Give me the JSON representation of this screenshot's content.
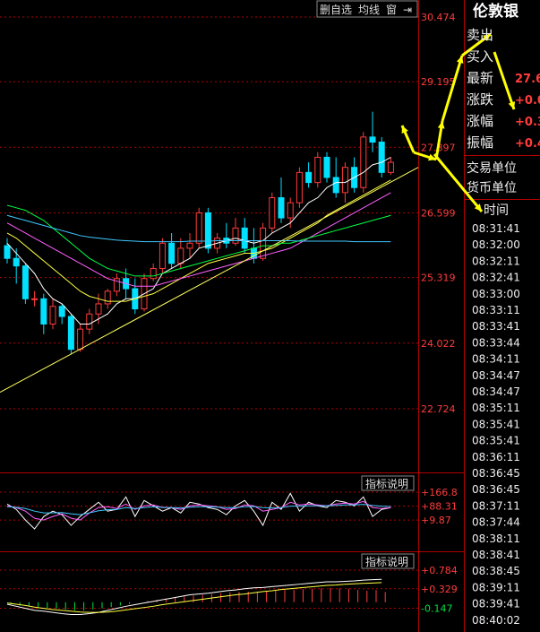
{
  "toolbar": {
    "btn_remove_self": "删自选",
    "btn_ma": "均线",
    "btn_window": "窗",
    "btn_arrow": "⇥"
  },
  "quote_panel": {
    "title": "伦敦银",
    "rows": [
      {
        "label": "卖出",
        "value": ""
      },
      {
        "label": "买入",
        "value": ""
      },
      {
        "label": "最新",
        "value": "27.6"
      },
      {
        "label": "涨跌",
        "value": "+0.0"
      },
      {
        "label": "涨幅",
        "value": "+0.3"
      },
      {
        "label": "振幅",
        "value": "+0.4"
      }
    ],
    "trade_unit_label": "交易单位",
    "currency_unit_label": "货币单位",
    "time_header": "时间",
    "times": [
      "08:31:41",
      "08:32:00",
      "08:32:11",
      "08:32:41",
      "08:33:00",
      "08:33:11",
      "08:33:41",
      "08:33:44",
      "08:34:11",
      "08:34:47",
      "08:34:47",
      "08:35:11",
      "08:35:41",
      "08:35:41",
      "08:36:11",
      "08:36:45",
      "08:36:45",
      "08:37:11",
      "08:37:44",
      "08:38:11",
      "08:38:41",
      "08:38:45",
      "08:39:11",
      "08:39:41",
      "08:40:02"
    ]
  },
  "colors": {
    "up": "#ff3c3c",
    "down": "#00e0ff",
    "bg": "#000000",
    "grid": "#b40000",
    "arrow": "#ffff00",
    "ma1": "#ffffff",
    "ma2": "#ffff40",
    "ma3": "#ff60ff",
    "ma4": "#00ff40",
    "ma5": "#40c8ff"
  },
  "chart_data": [
    {
      "type": "candlestick",
      "y_ticks": [
        "30.474",
        "29.195",
        "27.897",
        "26.599",
        "25.319",
        "24.022",
        "22.724"
      ],
      "ylim": [
        22.724,
        30.474
      ],
      "candles": [
        {
          "o": 25.95,
          "h": 26.1,
          "l": 25.6,
          "c": 25.7
        },
        {
          "o": 25.7,
          "h": 25.9,
          "l": 25.2,
          "c": 25.55
        },
        {
          "o": 25.55,
          "h": 25.6,
          "l": 24.8,
          "c": 24.9
        },
        {
          "o": 24.9,
          "h": 25.05,
          "l": 24.75,
          "c": 24.9
        },
        {
          "o": 24.9,
          "h": 25.0,
          "l": 24.2,
          "c": 24.4
        },
        {
          "o": 24.4,
          "h": 24.9,
          "l": 24.3,
          "c": 24.75
        },
        {
          "o": 24.75,
          "h": 24.8,
          "l": 24.4,
          "c": 24.55
        },
        {
          "o": 24.55,
          "h": 24.6,
          "l": 23.8,
          "c": 23.9
        },
        {
          "o": 23.9,
          "h": 24.4,
          "l": 23.85,
          "c": 24.3
        },
        {
          "o": 24.3,
          "h": 24.7,
          "l": 24.2,
          "c": 24.6
        },
        {
          "o": 24.6,
          "h": 25.0,
          "l": 24.4,
          "c": 24.8
        },
        {
          "o": 24.8,
          "h": 25.1,
          "l": 24.7,
          "c": 25.05
        },
        {
          "o": 25.05,
          "h": 25.4,
          "l": 24.95,
          "c": 25.3
        },
        {
          "o": 25.3,
          "h": 25.5,
          "l": 24.9,
          "c": 25.1
        },
        {
          "o": 25.1,
          "h": 25.3,
          "l": 24.6,
          "c": 24.7
        },
        {
          "o": 24.7,
          "h": 25.4,
          "l": 24.65,
          "c": 25.3
        },
        {
          "o": 25.3,
          "h": 25.6,
          "l": 25.25,
          "c": 25.5
        },
        {
          "o": 25.5,
          "h": 26.1,
          "l": 25.4,
          "c": 26.0
        },
        {
          "o": 26.0,
          "h": 26.2,
          "l": 25.5,
          "c": 25.6
        },
        {
          "o": 25.6,
          "h": 26.1,
          "l": 25.5,
          "c": 25.9
        },
        {
          "o": 25.9,
          "h": 26.2,
          "l": 25.7,
          "c": 26.0
        },
        {
          "o": 26.0,
          "h": 26.7,
          "l": 25.9,
          "c": 26.6
        },
        {
          "o": 26.6,
          "h": 26.7,
          "l": 25.8,
          "c": 25.9
        },
        {
          "o": 25.9,
          "h": 26.2,
          "l": 25.8,
          "c": 26.1
        },
        {
          "o": 26.1,
          "h": 26.4,
          "l": 25.9,
          "c": 26.0
        },
        {
          "o": 26.0,
          "h": 26.5,
          "l": 25.95,
          "c": 26.3
        },
        {
          "o": 26.3,
          "h": 26.5,
          "l": 25.8,
          "c": 25.9
        },
        {
          "o": 25.9,
          "h": 26.3,
          "l": 25.6,
          "c": 25.7
        },
        {
          "o": 25.7,
          "h": 26.4,
          "l": 25.65,
          "c": 26.3
        },
        {
          "o": 26.3,
          "h": 27.0,
          "l": 26.2,
          "c": 26.9
        },
        {
          "o": 26.9,
          "h": 27.3,
          "l": 26.4,
          "c": 26.5
        },
        {
          "o": 26.5,
          "h": 26.9,
          "l": 26.3,
          "c": 26.8
        },
        {
          "o": 26.8,
          "h": 27.5,
          "l": 26.7,
          "c": 27.4
        },
        {
          "o": 27.4,
          "h": 27.6,
          "l": 27.1,
          "c": 27.2
        },
        {
          "o": 27.2,
          "h": 27.8,
          "l": 27.1,
          "c": 27.7
        },
        {
          "o": 27.7,
          "h": 27.8,
          "l": 27.2,
          "c": 27.3
        },
        {
          "o": 27.3,
          "h": 27.7,
          "l": 26.9,
          "c": 27.0
        },
        {
          "o": 27.0,
          "h": 27.6,
          "l": 26.8,
          "c": 27.5
        },
        {
          "o": 27.5,
          "h": 27.7,
          "l": 27.0,
          "c": 27.1
        },
        {
          "o": 27.1,
          "h": 28.2,
          "l": 27.0,
          "c": 28.1
        },
        {
          "o": 28.1,
          "h": 28.6,
          "l": 27.8,
          "c": 28.0
        },
        {
          "o": 28.0,
          "h": 28.1,
          "l": 27.3,
          "c": 27.4
        },
        {
          "o": 27.4,
          "h": 27.7,
          "l": 27.35,
          "c": 27.6
        }
      ],
      "ma_lines": [
        {
          "color": "#ffffff",
          "values": [
            26.0,
            25.8,
            25.6,
            25.4,
            25.1,
            24.9,
            24.8,
            24.6,
            24.4,
            24.4,
            24.5,
            24.6,
            24.8,
            24.9,
            24.9,
            25.0,
            25.1,
            25.4,
            25.5,
            25.6,
            25.7,
            25.9,
            25.95,
            26.0,
            26.05,
            26.1,
            26.05,
            26.0,
            26.05,
            26.2,
            26.3,
            26.4,
            26.6,
            26.8,
            26.9,
            27.1,
            27.2,
            27.2,
            27.3,
            27.4,
            27.55,
            27.6,
            27.7
          ]
        },
        {
          "color": "#ffff40",
          "values": [
            26.2,
            26.1,
            25.95,
            25.8,
            25.65,
            25.5,
            25.35,
            25.2,
            25.05,
            24.95,
            24.9,
            24.85,
            24.85,
            24.85,
            24.9,
            24.95,
            25.0,
            25.1,
            25.2,
            25.3,
            25.4,
            25.5,
            25.6,
            25.65,
            25.7,
            25.75,
            25.8,
            25.8,
            25.85,
            25.9,
            26.0,
            26.1,
            26.2,
            26.3,
            26.4,
            26.55,
            26.65,
            26.75,
            26.85,
            26.95,
            27.05,
            27.15,
            27.25
          ]
        },
        {
          "color": "#ff60ff",
          "values": [
            26.4,
            26.3,
            26.2,
            26.1,
            26.0,
            25.9,
            25.8,
            25.7,
            25.6,
            25.5,
            25.4,
            25.3,
            25.25,
            25.2,
            25.15,
            25.15,
            25.15,
            25.2,
            25.25,
            25.3,
            25.35,
            25.4,
            25.45,
            25.5,
            25.55,
            25.6,
            25.65,
            25.7,
            25.75,
            25.8,
            25.85,
            25.9,
            26.0,
            26.1,
            26.2,
            26.3,
            26.4,
            26.5,
            26.6,
            26.7,
            26.8,
            26.9,
            27.0
          ]
        },
        {
          "color": "#00ff40",
          "values": [
            26.75,
            26.7,
            26.65,
            26.55,
            26.45,
            26.3,
            26.15,
            26.0,
            25.85,
            25.7,
            25.6,
            25.5,
            25.45,
            25.4,
            25.35,
            25.35,
            25.35,
            25.4,
            25.45,
            25.5,
            25.55,
            25.6,
            25.65,
            25.7,
            25.75,
            25.8,
            25.85,
            25.9,
            25.95,
            25.95,
            26.0,
            26.0,
            26.05,
            26.1,
            26.15,
            26.2,
            26.25,
            26.3,
            26.35,
            26.4,
            26.45,
            26.5,
            26.55
          ]
        },
        {
          "color": "#40c8ff",
          "values": [
            26.55,
            26.5,
            26.45,
            26.4,
            26.35,
            26.3,
            26.25,
            26.2,
            26.15,
            26.12,
            26.1,
            26.08,
            26.06,
            26.05,
            26.04,
            26.03,
            26.03,
            26.03,
            26.03,
            26.03,
            26.04,
            26.04,
            26.04,
            26.05,
            26.05,
            26.05,
            26.05,
            26.05,
            26.05,
            26.05,
            26.05,
            26.05,
            26.04,
            26.04,
            26.04,
            26.04,
            26.04,
            26.04,
            26.03,
            26.03,
            26.03,
            26.03,
            26.03
          ]
        }
      ],
      "trendline": {
        "from": [
          0,
          23.05
        ],
        "to": [
          45,
          27.5
        ]
      }
    },
    {
      "type": "line",
      "label": "指标说明",
      "y_ticks": [
        "+166.8",
        "+88.31",
        "+9.87"
      ],
      "ylim": [
        -60,
        166.8
      ],
      "series": [
        {
          "color": "#ffffff",
          "values": [
            100,
            70,
            10,
            -40,
            30,
            60,
            40,
            -20,
            30,
            70,
            110,
            60,
            70,
            140,
            30,
            120,
            90,
            60,
            80,
            50,
            110,
            100,
            80,
            70,
            40,
            90,
            120,
            60,
            -20,
            110,
            70,
            160,
            60,
            110,
            90,
            80,
            120,
            110,
            90,
            140,
            30,
            70,
            80
          ]
        },
        {
          "color": "#ff60ff",
          "values": [
            90,
            80,
            60,
            20,
            10,
            30,
            45,
            20,
            10,
            50,
            80,
            85,
            75,
            100,
            70,
            90,
            95,
            80,
            80,
            70,
            90,
            95,
            90,
            85,
            70,
            75,
            95,
            90,
            60,
            70,
            80,
            110,
            95,
            100,
            95,
            90,
            100,
            105,
            100,
            115,
            80,
            75,
            80
          ]
        },
        {
          "color": "#40c8ff",
          "values": [
            85,
            82,
            75,
            60,
            50,
            50,
            52,
            45,
            40,
            50,
            62,
            68,
            70,
            80,
            75,
            80,
            85,
            82,
            80,
            78,
            82,
            85,
            85,
            83,
            80,
            80,
            85,
            86,
            80,
            78,
            80,
            88,
            88,
            90,
            90,
            90,
            92,
            95,
            95,
            98,
            92,
            88,
            86
          ]
        }
      ]
    },
    {
      "type": "macd",
      "label": "指标说明",
      "y_ticks": [
        "+0.784",
        "+0.329",
        "-0.147"
      ],
      "ylim": [
        -0.4,
        0.784
      ],
      "bars": [
        -0.05,
        -0.08,
        -0.1,
        -0.12,
        -0.14,
        -0.16,
        -0.18,
        -0.2,
        -0.2,
        -0.18,
        -0.15,
        -0.12,
        -0.08,
        -0.04,
        0.0,
        0.03,
        0.06,
        0.09,
        0.12,
        0.14,
        0.16,
        0.18,
        0.2,
        0.22,
        0.24,
        0.25,
        0.26,
        0.26,
        0.27,
        0.28,
        0.3,
        0.31,
        0.32,
        0.33,
        0.34,
        0.35,
        0.34,
        0.33,
        0.3,
        0.28,
        0.3,
        0.25
      ],
      "dif": [
        -0.05,
        -0.1,
        -0.15,
        -0.2,
        -0.22,
        -0.25,
        -0.28,
        -0.3,
        -0.3,
        -0.28,
        -0.25,
        -0.2,
        -0.15,
        -0.1,
        -0.06,
        -0.02,
        0.02,
        0.06,
        0.1,
        0.14,
        0.18,
        0.2,
        0.22,
        0.25,
        0.28,
        0.3,
        0.33,
        0.35,
        0.36,
        0.38,
        0.4,
        0.42,
        0.44,
        0.46,
        0.48,
        0.5,
        0.5,
        0.51,
        0.52,
        0.54,
        0.55,
        0.56
      ],
      "dea": [
        -0.02,
        -0.05,
        -0.08,
        -0.12,
        -0.15,
        -0.18,
        -0.2,
        -0.22,
        -0.24,
        -0.25,
        -0.25,
        -0.24,
        -0.22,
        -0.19,
        -0.16,
        -0.13,
        -0.1,
        -0.06,
        -0.03,
        0.0,
        0.03,
        0.06,
        0.09,
        0.12,
        0.15,
        0.18,
        0.2,
        0.23,
        0.26,
        0.28,
        0.31,
        0.33,
        0.35,
        0.37,
        0.39,
        0.41,
        0.42,
        0.44,
        0.45,
        0.46,
        0.47,
        0.48
      ]
    }
  ]
}
